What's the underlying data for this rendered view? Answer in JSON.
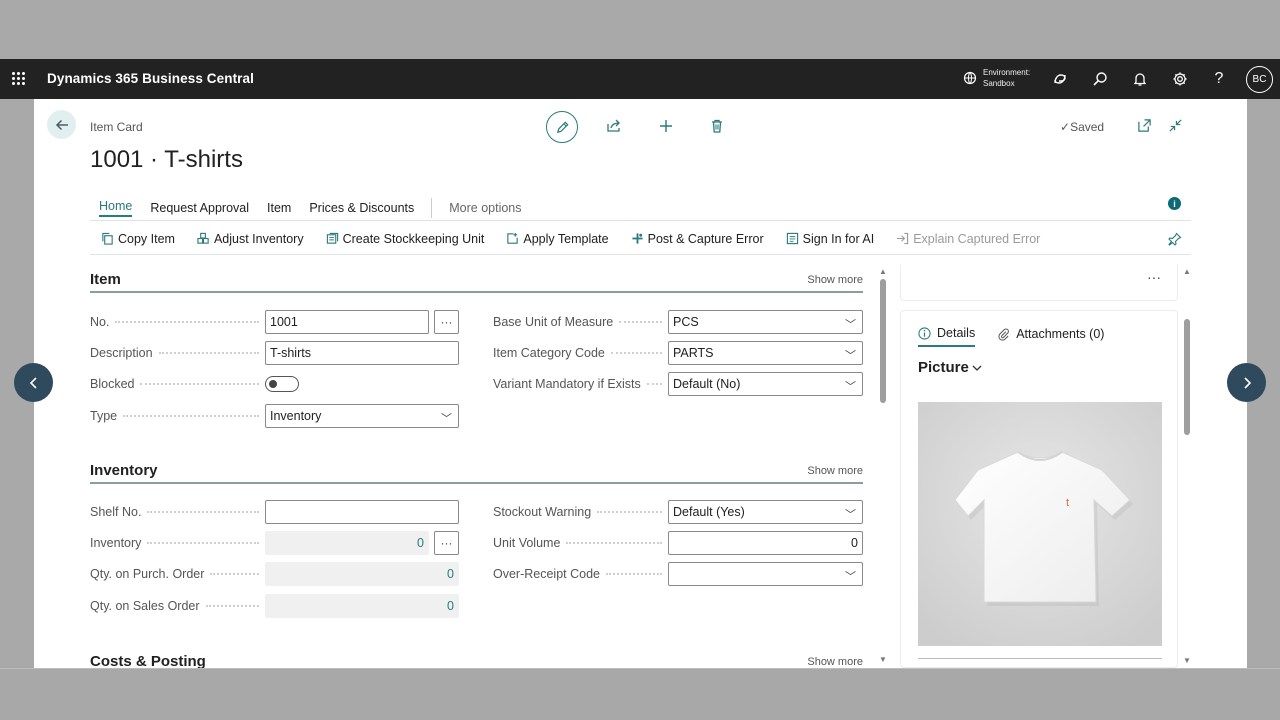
{
  "appbar": {
    "brand": "Dynamics 365 Business Central",
    "environment_label": "Environment:",
    "environment_value": "Sandbox",
    "avatar_initials": "BC"
  },
  "page": {
    "breadcrumb": "Item Card",
    "title": "1001 · T-shirts",
    "saved_label": "Saved"
  },
  "tabs": [
    {
      "label": "Home"
    },
    {
      "label": "Request Approval"
    },
    {
      "label": "Item"
    },
    {
      "label": "Prices & Discounts"
    },
    {
      "label": "More options"
    }
  ],
  "actions": [
    {
      "label": "Copy Item",
      "icon": "copy-icon"
    },
    {
      "label": "Adjust Inventory",
      "icon": "adjust-inventory-icon"
    },
    {
      "label": "Create Stockkeeping Unit",
      "icon": "stockkeeping-icon"
    },
    {
      "label": "Apply Template",
      "icon": "apply-template-icon"
    },
    {
      "label": "Post & Capture Error",
      "icon": "post-capture-icon"
    },
    {
      "label": "Sign In for AI",
      "icon": "sign-in-icon"
    },
    {
      "label": "Explain Captured Error",
      "icon": "explain-error-icon"
    }
  ],
  "sections": {
    "item": {
      "title": "Item",
      "show_more": "Show more",
      "fields": {
        "no_label": "No.",
        "no_value": "1001",
        "description_label": "Description",
        "description_value": "T-shirts",
        "blocked_label": "Blocked",
        "blocked_on": false,
        "type_label": "Type",
        "type_value": "Inventory",
        "base_uom_label": "Base Unit of Measure",
        "base_uom_value": "PCS",
        "category_label": "Item Category Code",
        "category_value": "PARTS",
        "variant_label": "Variant Mandatory if Exists",
        "variant_value": "Default (No)"
      }
    },
    "inventory": {
      "title": "Inventory",
      "show_more": "Show more",
      "fields": {
        "shelf_label": "Shelf No.",
        "shelf_value": "",
        "inventory_label": "Inventory",
        "inventory_value": "0",
        "purch_label": "Qty. on Purch. Order",
        "purch_value": "0",
        "sales_label": "Qty. on Sales Order",
        "sales_value": "0",
        "stockout_label": "Stockout Warning",
        "stockout_value": "Default (Yes)",
        "volume_label": "Unit Volume",
        "volume_value": "0",
        "overreceipt_label": "Over-Receipt Code",
        "overreceipt_value": ""
      }
    },
    "costs": {
      "title": "Costs & Posting",
      "show_more": "Show more"
    }
  },
  "factbox": {
    "more_label": "···",
    "tab_details": "Details",
    "tab_attachments": "Attachments (0)",
    "picture_label": "Picture",
    "tshirt_print": "t"
  },
  "colors": {
    "accent": "#2a7a7e",
    "appbar": "#222222",
    "nav_arrow": "#2e4a5c"
  }
}
